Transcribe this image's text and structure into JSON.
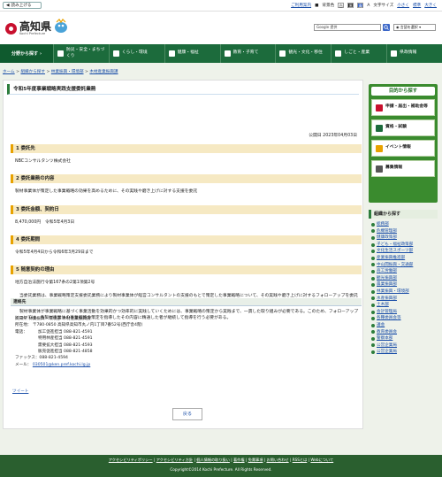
{
  "toolbar": {
    "read_aloud": "読み上げる",
    "links": [
      "ご利用案内",
      "背景色",
      "白",
      "黒",
      "青",
      "文字サイズ",
      "小さく",
      "標準",
      "大きく"
    ],
    "icons": [
      "speaker-icon",
      "info-icon",
      "palette-icon",
      "text-size-icon"
    ]
  },
  "header": {
    "logo_name": "高知県",
    "logo_en": "Kochi Prefecture",
    "search_placeholder": "Google 提供",
    "language": "言語を選択"
  },
  "nav": {
    "find": "分野から探す",
    "items": [
      "防災・安全・まちづくり",
      "くらし・環境",
      "健康・福祉",
      "教育・子育て",
      "観光・文化・移住",
      "しごと・産業",
      "県政情報"
    ]
  },
  "breadcrumb": [
    "ホーム",
    "組織から探す",
    "林業振興・環境部",
    "木材産業振興課"
  ],
  "page": {
    "title": "令和5年度事業戦略実践支援委託業務",
    "published": "公開日 2023年04月03日",
    "sections": [
      {
        "title": "1 委託先",
        "body": "NBCコンサルタンツ株式会社"
      },
      {
        "title": "2 委託業務の内容",
        "body": "製材事業体が策定した事業戦略の効果を高めるために、その実践や磨き上げに対する支援を委託"
      },
      {
        "title": "3 委託金額、契約日",
        "body": "8,470,000円　令和5年4月3日"
      },
      {
        "title": "4 委託期間",
        "body": "令和5年4月4日から令和6年3月29日まで"
      },
      {
        "title": "5 随意契約の理由",
        "body": "地方自治法施行令第167条の2第1項第2号"
      }
    ],
    "reason_paragraphs": [
      "当委託業務は、事業戦略策定支援委託業務により製材事業体が経営コンサルタントの支援のもとで策定した事業戦略について、その実践や磨き上げに対するフォローアップを委託するものである。",
      "製材事業体が事業戦略に基づく事業活動を効果的かつ効率的に実践していくためには、事業戦略の策定から実践まで、一貫した取り組みが必要である。このため、フォローアップについては、各製材事業体の事業戦略の策定を指導したその内容に精通した者が継続して指導を行う必要がある。"
    ]
  },
  "contact": {
    "title": "連絡先",
    "org": "高知県 林業振興・環境部 木材産業振興課",
    "address_label": "所在地：",
    "address": "〒780-0850 高知県高知市丸ノ内1丁目7番52号(西庁舎4階)",
    "phone_label": "電話：",
    "phones": [
      "加工促進担当 088-821-4591",
      "特用林産担当 088-821-4591",
      "需要拡大担当 088-821-4593",
      "販売促進担当 088-821-4858"
    ],
    "fax": "ファックス：088-821-4594",
    "mail_label": "メール：",
    "mail": "030501@ken.pref.kochi.lg.jp"
  },
  "tweet": "ツイート",
  "back_to_top": "戻る",
  "sidebar": {
    "purpose_title": "目的から探す",
    "purpose_items": [
      "申請・届出・補助金等",
      "資格・試験",
      "イベント情報",
      "募集情報"
    ],
    "org_title": "組織から探す",
    "org_items": [
      "総務部",
      "危機管理部",
      "健康政策部",
      "子ども・福祉政策部",
      "文化生活スポーツ部",
      "産業振興推進部",
      "中山間振興・交通部",
      "商工労働部",
      "観光振興部",
      "農業振興部",
      "林業振興・環境部",
      "水産振興部",
      "土木部",
      "会計管理局",
      "各種委員会等",
      "議会",
      "教育委員会",
      "警察本部",
      "公営企業局",
      "公営企業局"
    ]
  },
  "footer": {
    "links": [
      "アクセシビリティポリシー",
      "アクセシビリティ方針",
      "個人情報の取り扱い",
      "著作権",
      "免責事項",
      "お問い合わせ",
      "RSSとは",
      "Webについて"
    ],
    "copyright": "Copyright©2014 Kochi Prefecture. All Rights Reserved."
  },
  "colors": {
    "accent": "#1c6b3c",
    "section": "#f6e9c3",
    "side": "#3a8b2e"
  }
}
